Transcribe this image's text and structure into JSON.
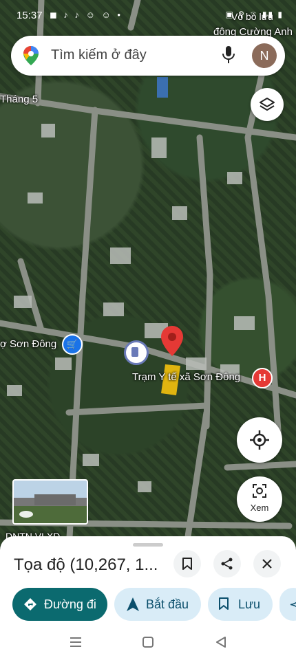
{
  "status": {
    "time": "15:37",
    "icons": "◼ ♪ ♪ ☺ ☺ •",
    "right": "▣ ⚲ ⌔ ▮▮ ▮"
  },
  "search": {
    "placeholder": "Tìm kiếm ở đây",
    "avatar_initial": "N"
  },
  "map": {
    "labels": {
      "top_right": "Vỏ bò lưu",
      "top_right_2": "đông Cường Anh",
      "street": "Tháng 5",
      "market": "ợ Sơn Đông",
      "health": "Trạm Y tế xã Sơn Đông",
      "bottom_left": "DNTN VLXD"
    },
    "view_label": "Xem"
  },
  "sheet": {
    "coordinates": "Tọa độ (10,267, 1...",
    "chips": {
      "directions": "Đường đi",
      "start": "Bắt đầu",
      "save": "Lưu"
    }
  },
  "colors": {
    "accent": "#0b6a6f",
    "chip": "#d9ecf7",
    "pin": "#e53935",
    "hospital": "#e53935"
  }
}
